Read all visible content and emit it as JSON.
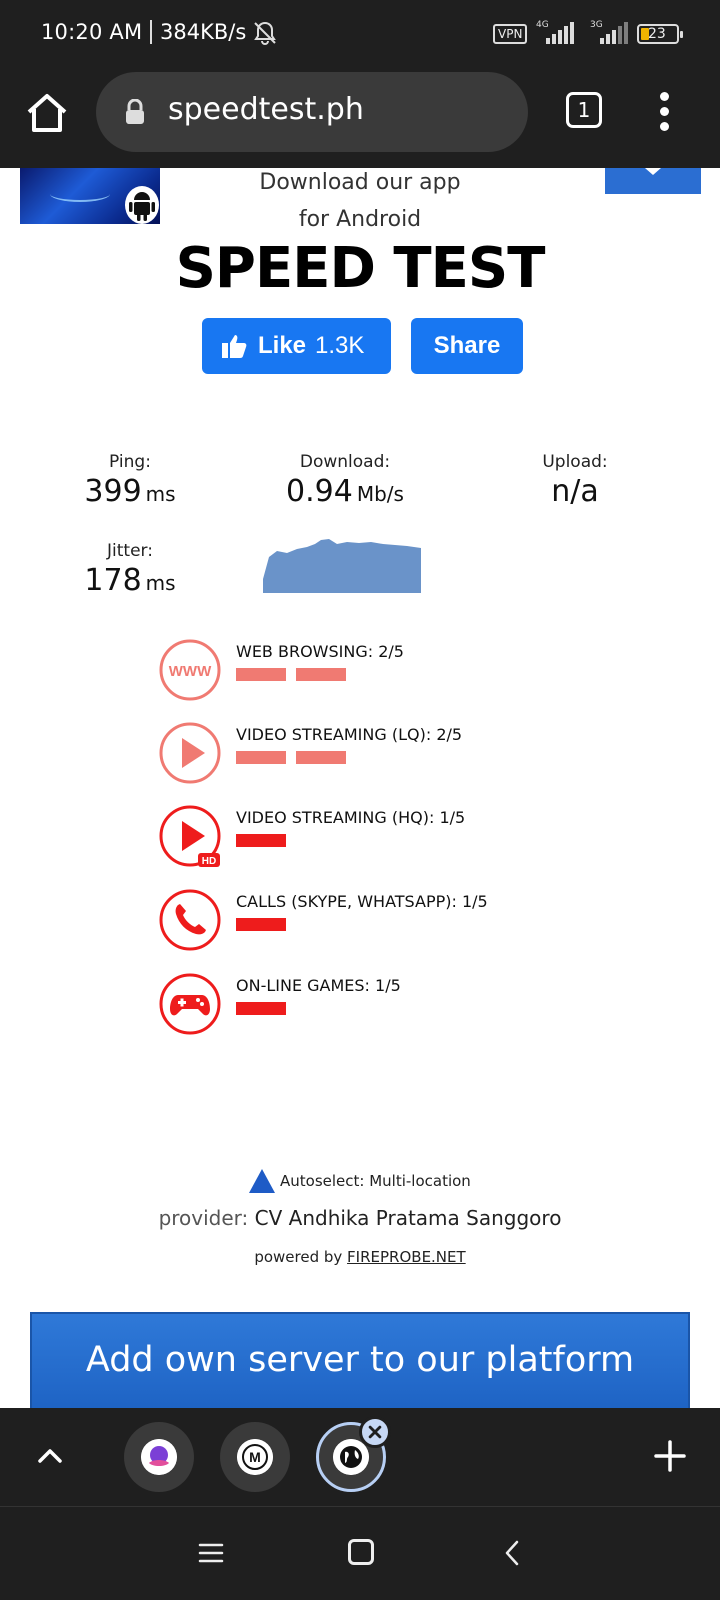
{
  "status_bar": {
    "time": "10:20 AM",
    "net_speed": "384KB/s",
    "vpn": "VPN",
    "signal_1": "4G",
    "signal_2": "3G",
    "battery": "23"
  },
  "browser": {
    "url": "speedtest.ph",
    "tab_count": "1"
  },
  "page": {
    "download_app_line1": "Download our app",
    "download_app_line2": "for Android",
    "title": "SPEED TEST",
    "like_label": "Like",
    "like_count": "1.3K",
    "share_label": "Share"
  },
  "metrics": {
    "ping_label": "Ping:",
    "ping_value": "399",
    "ping_unit": "ms",
    "download_label": "Download:",
    "download_value": "0.94",
    "download_unit": "Mb/s",
    "upload_label": "Upload:",
    "upload_value": "n/a",
    "jitter_label": "Jitter:",
    "jitter_value": "178",
    "jitter_unit": "ms"
  },
  "quality": [
    {
      "label": "WEB BROWSING: 2/5",
      "score": 2,
      "max": 5,
      "icon": "www-icon",
      "color": "#f07a72"
    },
    {
      "label": "VIDEO STREAMING (LQ): 2/5",
      "score": 2,
      "max": 5,
      "icon": "play-icon",
      "color": "#f07a72"
    },
    {
      "label": "VIDEO STREAMING (HQ): 1/5",
      "score": 1,
      "max": 5,
      "icon": "play-hd-icon",
      "color": "#ee1c1c"
    },
    {
      "label": "CALLS (SKYPE, WHATSAPP): 1/5",
      "score": 1,
      "max": 5,
      "icon": "phone-icon",
      "color": "#ee1c1c"
    },
    {
      "label": "ON-LINE GAMES: 1/5",
      "score": 1,
      "max": 5,
      "icon": "gamepad-icon",
      "color": "#ee1c1c"
    }
  ],
  "server": {
    "autoselect": "Autoselect: Multi-location",
    "provider_label": "provider:",
    "provider_name": "CV Andhika Pratama Sanggoro",
    "powered_by": "powered by",
    "powered_link": "FIREPROBE.NET",
    "add_server": "Add own server to our platform"
  },
  "colors": {
    "accent_blue": "#1877f2",
    "bad_red": "#ee1c1c",
    "weak_red": "#f07a72",
    "graph_fill": "#6a93c9"
  }
}
